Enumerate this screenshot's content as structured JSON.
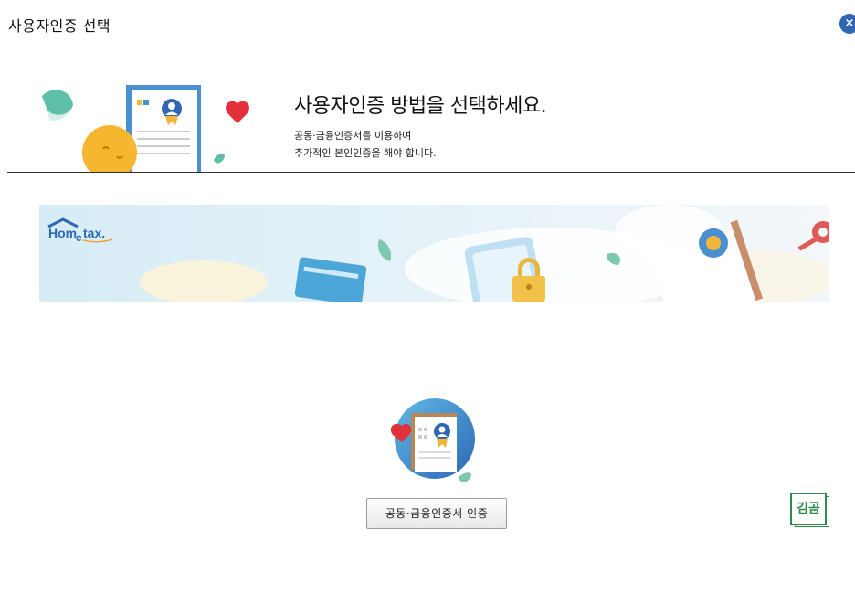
{
  "window": {
    "title": "사용자인증 선택",
    "close_label": "×"
  },
  "hero": {
    "title": "사용자인증 방법을 선택하세요.",
    "description_line1": "공동·금융인증서를 이용하여",
    "description_line2": "추가적인 본인인증을 해야 합니다."
  },
  "banner": {
    "logo_text_pre": "Hom",
    "logo_text_e": "e",
    "logo_text_post": "tax."
  },
  "auth": {
    "cert_button_label": "공동·금융인증서 인증"
  },
  "kimgom": {
    "label": "김곰"
  },
  "colors": {
    "accent_blue": "#2f67b4",
    "kimgom_green": "#2e8b4a"
  }
}
